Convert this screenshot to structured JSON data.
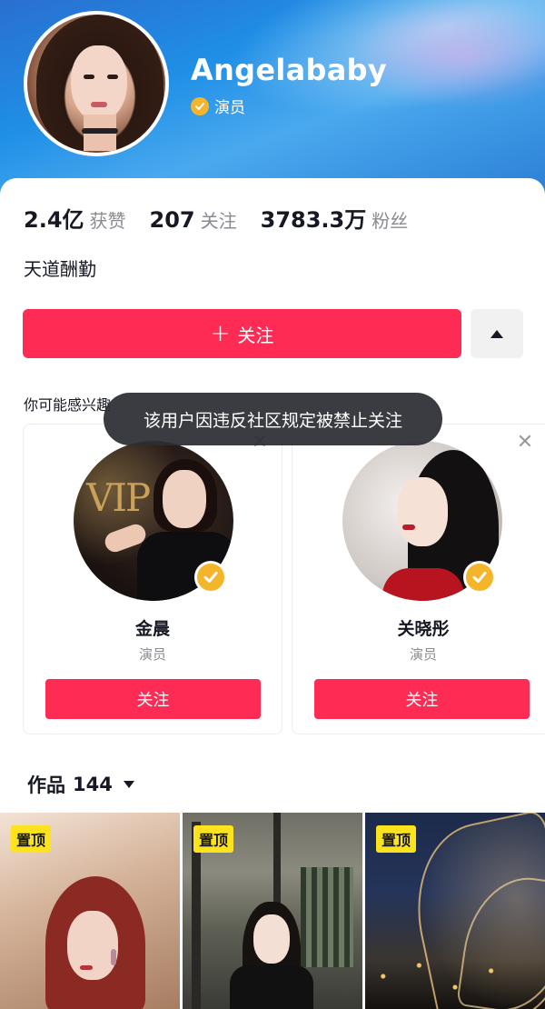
{
  "profile": {
    "name": "Angelababy",
    "role": "演员",
    "bio": "天道酬勤"
  },
  "stats": [
    {
      "value": "2.4亿",
      "label": "获赞"
    },
    {
      "value": "207",
      "label": "关注"
    },
    {
      "value": "3783.3万",
      "label": "粉丝"
    }
  ],
  "actions": {
    "follow_plus": "+",
    "follow_label": "关注"
  },
  "recommend": {
    "section_label": "你可能感兴趣",
    "users": [
      {
        "name": "金晨",
        "role": "演员",
        "follow_label": "关注"
      },
      {
        "name": "关晓彤",
        "role": "演员",
        "follow_label": "关注"
      }
    ]
  },
  "toast": {
    "message": "该用户因违反社区规定被禁止关注"
  },
  "works": {
    "label": "作品",
    "count": "144"
  },
  "thumbs": [
    {
      "badge": "置顶"
    },
    {
      "badge": "置顶"
    },
    {
      "badge": "置顶"
    }
  ],
  "colors": {
    "accent": "#fe2c55",
    "verified": "#f5b52a",
    "pin_badge": "#fce31d"
  },
  "icons": {
    "verified": "check-badge-icon",
    "close": "close-icon",
    "more": "triangle-up-icon",
    "dropdown": "caret-down-icon"
  }
}
